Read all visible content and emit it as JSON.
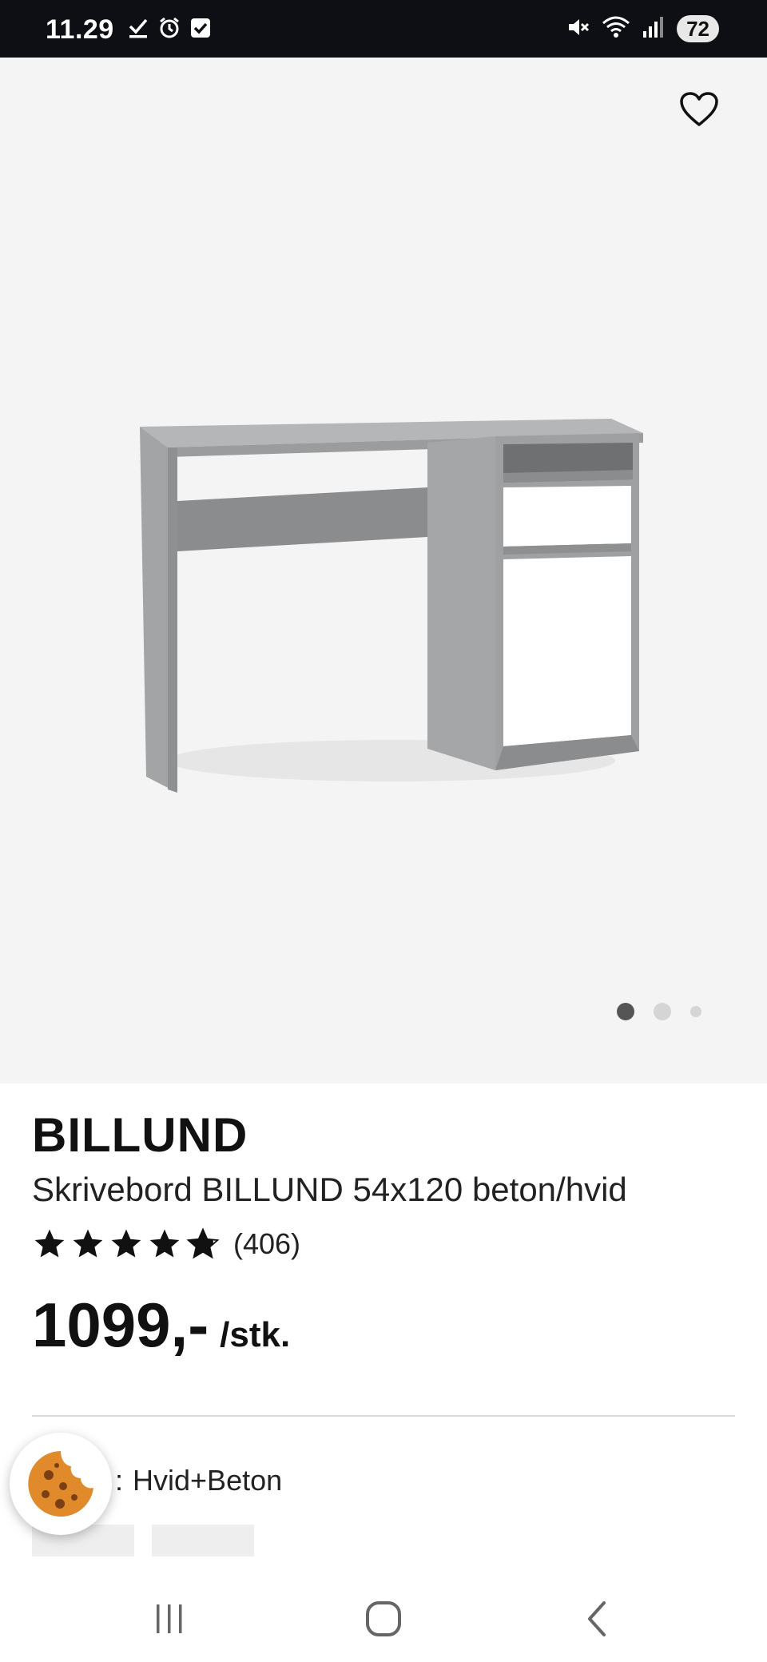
{
  "status_bar": {
    "time": "11.29",
    "battery": "72",
    "icons_left": [
      "download-done-icon",
      "alarm-icon",
      "checkbox-icon"
    ],
    "icons_right": [
      "mute-icon",
      "wifi-icon",
      "signal-icon"
    ]
  },
  "gallery": {
    "image_count": 3,
    "active_index": 0,
    "favorite_icon": "heart-outline-icon"
  },
  "product": {
    "brand": "BILLUND",
    "name": "Skrivebord BILLUND 54x120 beton/hvid",
    "rating_value": 4.8,
    "review_count": "(406)",
    "price": "1099,-",
    "unit": "/stk."
  },
  "variant": {
    "separator": ":",
    "value": "Hvid+Beton"
  },
  "colors": {
    "gallery_bg": "#f4f4f4",
    "status_bg": "#0d0f14",
    "cookie": "#e08a2c"
  },
  "nav": {
    "items": [
      "recent-apps-icon",
      "home-icon",
      "back-icon"
    ]
  }
}
